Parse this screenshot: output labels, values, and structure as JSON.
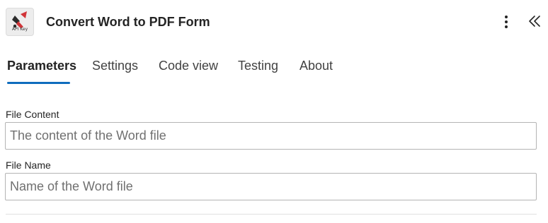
{
  "header": {
    "title": "Convert Word to PDF Form",
    "app_icon": {
      "name": "api-key-connector-icon",
      "caption": "API Key"
    },
    "more_icon": "more-vertical-icon",
    "collapse_icon": "double-chevron-left-icon"
  },
  "tabs": [
    {
      "label": "Parameters",
      "active": true
    },
    {
      "label": "Settings",
      "active": false
    },
    {
      "label": "Code view",
      "active": false
    },
    {
      "label": "Testing",
      "active": false
    },
    {
      "label": "About",
      "active": false
    }
  ],
  "form": {
    "file_content": {
      "label": "File Content",
      "value": "",
      "placeholder": "The content of the Word file"
    },
    "file_name": {
      "label": "File Name",
      "value": "",
      "placeholder": "Name of the Word file"
    }
  },
  "colors": {
    "accent": "#0f6cbd",
    "logo_red": "#d13438",
    "text": "#242424"
  }
}
